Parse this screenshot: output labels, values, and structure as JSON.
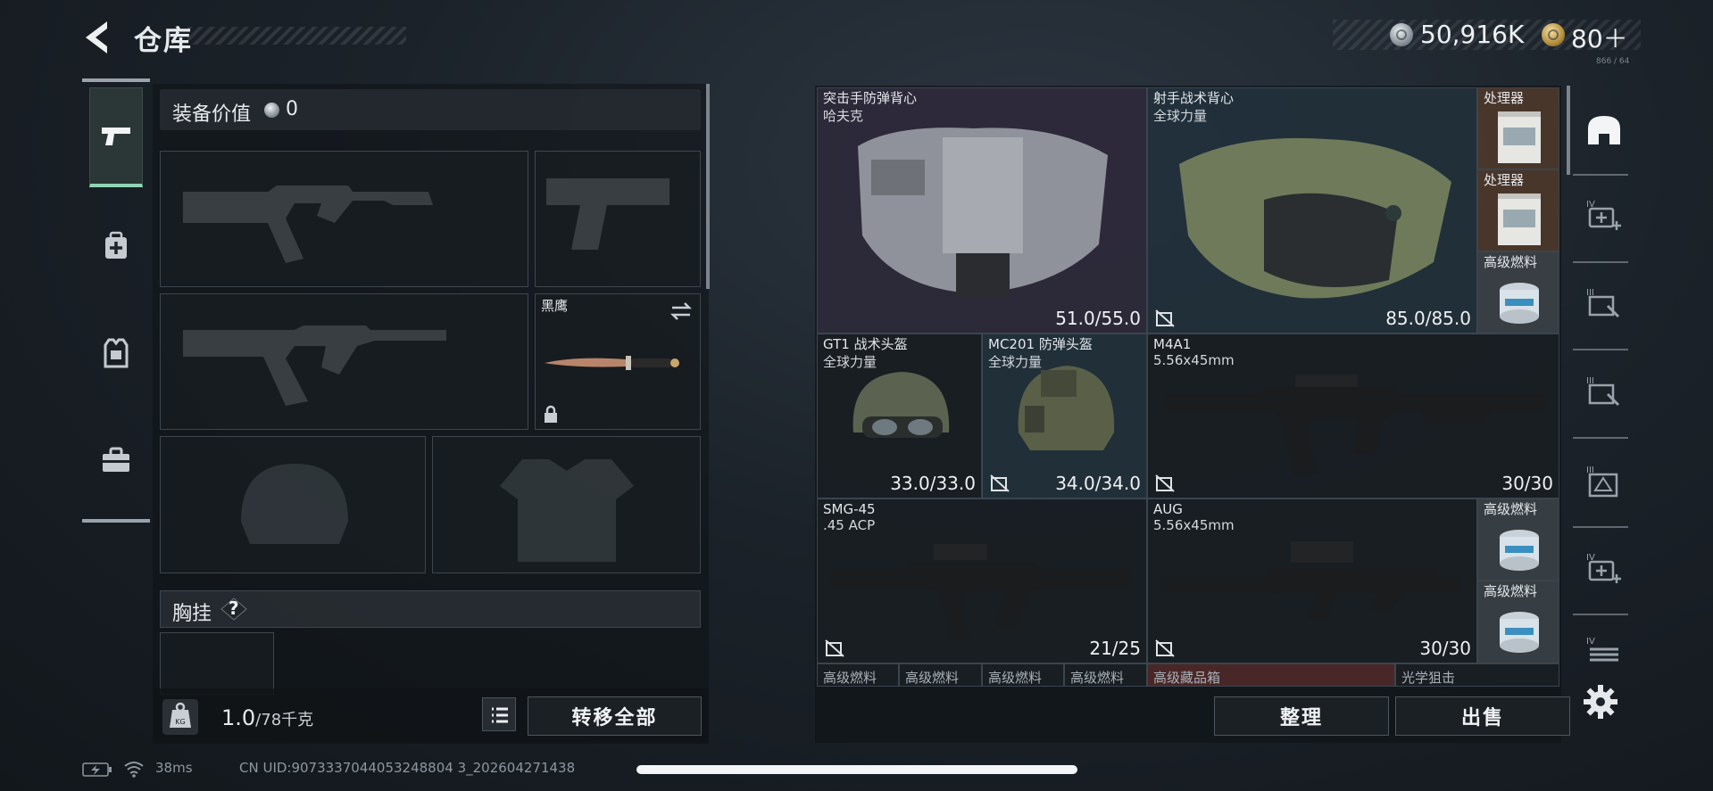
{
  "header": {
    "title": "仓库",
    "silver_amount": "50,916K",
    "gold_amount": "80＋",
    "small_code": "866 / 64"
  },
  "tabs": [
    "weapon-tab",
    "medical-tab",
    "vest-tab",
    "toolbox-tab"
  ],
  "equip": {
    "value_label": "装备价值",
    "value": "0",
    "knife_name": "黑鹰",
    "chest_label": "胸挂",
    "help": "?"
  },
  "weight": {
    "current": "1.0",
    "max": "/78千克"
  },
  "buttons": {
    "transfer_all": "转移全部",
    "organize": "整理",
    "sell": "出售"
  },
  "grid": {
    "items": [
      {
        "name": "突击手防弹背心",
        "sub": "哈夫克",
        "durability": "51.0/55.0"
      },
      {
        "name": "射手战术背心",
        "sub": "全球力量",
        "durability": "85.0/85.0"
      },
      {
        "name": "处理器",
        "sub": "",
        "durability": ""
      },
      {
        "name": "处理器",
        "sub": "",
        "durability": ""
      },
      {
        "name": "高级燃料",
        "sub": "",
        "durability": ""
      },
      {
        "name": "GT1 战术头盔",
        "sub": "全球力量",
        "durability": "33.0/33.0"
      },
      {
        "name": "MC201 防弹头盔",
        "sub": "全球力量",
        "durability": "34.0/34.0"
      },
      {
        "name": "M4A1",
        "sub": "5.56x45mm",
        "durability": "30/30"
      },
      {
        "name": "SMG-45",
        "sub": ".45 ACP",
        "durability": "21/25"
      },
      {
        "name": "AUG",
        "sub": "5.56x45mm",
        "durability": "30/30"
      },
      {
        "name": "高级燃料",
        "sub": "",
        "durability": ""
      },
      {
        "name": "高级燃料",
        "sub": "",
        "durability": ""
      }
    ],
    "bottom_row": [
      "高级燃料",
      "高级燃料",
      "高级燃料",
      "高级燃料",
      "高级藏品箱",
      "光学狙击"
    ]
  },
  "filters": [
    "helmet-icon",
    "tier-iv-medkit-icon",
    "tier-iii-repair-icon",
    "tier-iii-repair-icon",
    "tier-iii-armor-icon",
    "tier-iv-medkit-icon",
    "tier-iv-ammo-icon"
  ],
  "status": {
    "ping": "38ms",
    "uid": "CN UID:9073337044053248804 3_202604271438"
  },
  "colors": {
    "accent_green": "#8fd4b6",
    "purple_rarity": "#342e42",
    "blue_rarity": "#243440",
    "gold_rarity": "#523c2e"
  }
}
